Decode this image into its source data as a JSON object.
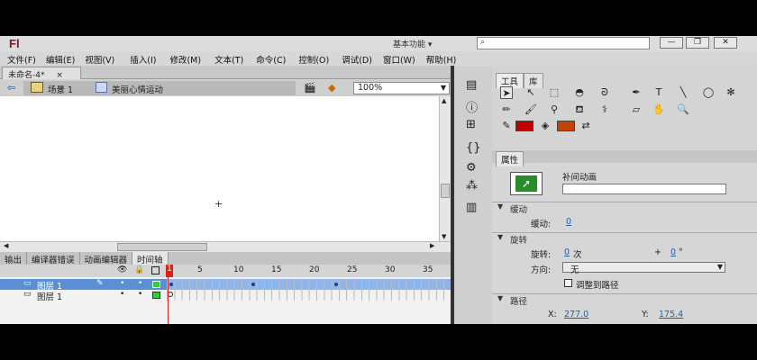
{
  "app": {
    "logo": "Fl",
    "workspace": "基本功能 ▾",
    "search_placeholder": ""
  },
  "window_controls": {
    "minimize": "—",
    "restore": "❐",
    "close": "✕"
  },
  "menu": [
    "文件(F)",
    "编辑(E)",
    "视图(V)",
    "插入(I)",
    "修改(M)",
    "文本(T)",
    "命令(C)",
    "控制(O)",
    "调试(D)",
    "窗口(W)",
    "帮助(H)"
  ],
  "document_tab": {
    "title": "未命名-4*",
    "close": "×"
  },
  "editbar": {
    "scene": "场景 1",
    "symbol": "美丽心情运动",
    "zoom": "100%"
  },
  "timeline": {
    "tabs": [
      "输出",
      "编译器错误",
      "动画编辑器",
      "时间轴"
    ],
    "ruler": [
      "1",
      "5",
      "10",
      "15",
      "20",
      "25",
      "30",
      "35"
    ],
    "layers": [
      {
        "name": "图层 1",
        "selected": true
      },
      {
        "name": "图层 1",
        "selected": false
      }
    ],
    "playhead_frame": "1"
  },
  "tools_panel": {
    "tabs": [
      "工具",
      "库"
    ]
  },
  "properties": {
    "tab": "属性",
    "instance_label": "补间动画",
    "instance_name": "",
    "easing": {
      "section": "缓动",
      "label": "缓动:",
      "value": "0"
    },
    "rotation": {
      "section": "旋转",
      "label": "旋转:",
      "count": "0",
      "unit": "次",
      "plus": "+",
      "degrees": "0",
      "deg_unit": "°"
    },
    "direction": {
      "label": "方向:",
      "value": "无"
    },
    "orient_to_path": "调整到路径",
    "path": {
      "section": "路径",
      "x_label": "X:",
      "x_value": "277.0",
      "y_label": "Y:",
      "y_value": "175.4"
    }
  },
  "colors": {
    "stroke": "#c00000",
    "fill": "#c24400",
    "selected_row": "#5a8fd6"
  }
}
